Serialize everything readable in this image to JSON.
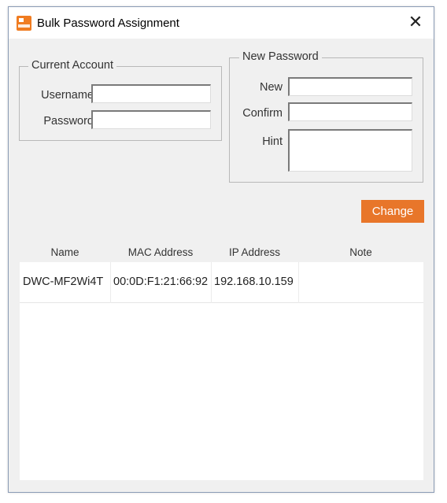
{
  "window": {
    "title": "Bulk Password Assignment",
    "close_glyph": "✕",
    "accent_color": "#e8762a",
    "app_icon": "app-logo-icon"
  },
  "current_account": {
    "legend": "Current Account",
    "username_label": "Username",
    "username_value": "",
    "password_label": "Password",
    "password_value": ""
  },
  "new_password": {
    "legend": "New Password",
    "new_label": "New",
    "new_value": "",
    "confirm_label": "Confirm",
    "confirm_value": "",
    "hint_label": "Hint",
    "hint_value": ""
  },
  "change_button": {
    "label": "Change"
  },
  "table": {
    "columns": [
      "Name",
      "MAC Address",
      "IP Address",
      "Note"
    ],
    "rows": [
      {
        "name": "DWC-MF2Wi4T",
        "mac": "00:0D:F1:21:66:92",
        "ip": "192.168.10.159",
        "note": ""
      }
    ]
  }
}
